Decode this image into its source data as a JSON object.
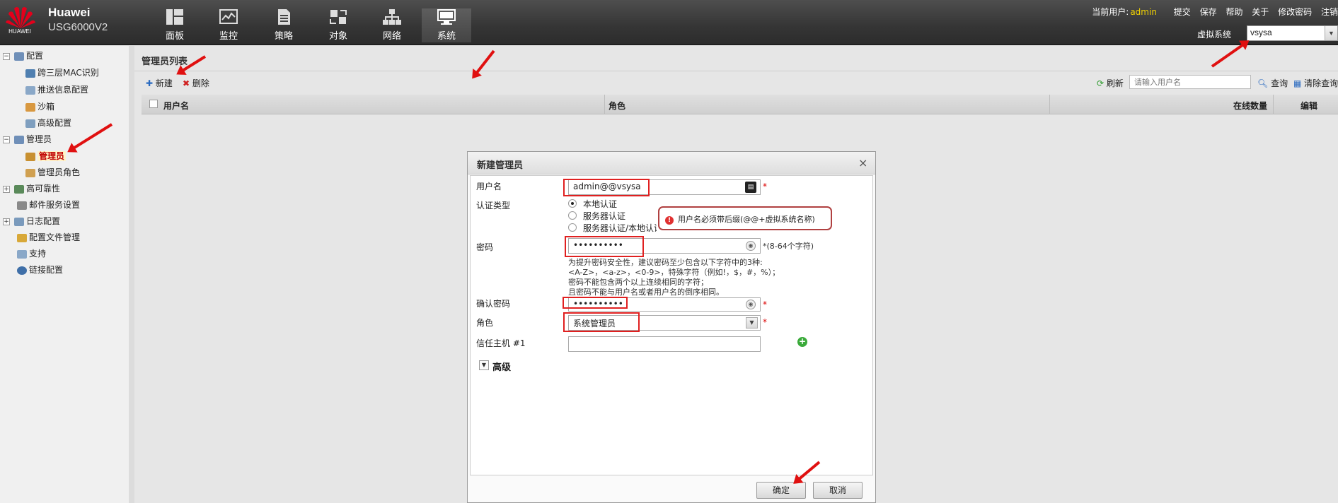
{
  "brand": {
    "logo_text": "HUAWEI",
    "name": "Huawei",
    "model": "USG6000V2"
  },
  "nav": [
    {
      "label": "面板",
      "icon": "dashboard-icon"
    },
    {
      "label": "监控",
      "icon": "monitor-icon"
    },
    {
      "label": "策略",
      "icon": "policy-icon"
    },
    {
      "label": "对象",
      "icon": "object-icon"
    },
    {
      "label": "网络",
      "icon": "network-icon"
    },
    {
      "label": "系统",
      "icon": "system-icon",
      "active": true
    }
  ],
  "topbar": {
    "current_user_label": "当前用户:",
    "current_user": "admin",
    "links": [
      "提交",
      "保存",
      "帮助",
      "关于",
      "修改密码",
      "注销"
    ]
  },
  "vsys": {
    "label": "虚拟系统",
    "value": "vsysa"
  },
  "sidebar": {
    "items": [
      {
        "label": "配置",
        "expander": "−"
      },
      {
        "label": "跨三层MAC识别"
      },
      {
        "label": "推送信息配置"
      },
      {
        "label": "沙箱"
      },
      {
        "label": "高级配置"
      },
      {
        "label": "管理员",
        "expander": "−"
      },
      {
        "label": "管理员",
        "selected": true
      },
      {
        "label": "管理员角色"
      },
      {
        "label": "高可靠性",
        "expander": "+"
      },
      {
        "label": "邮件服务设置"
      },
      {
        "label": "日志配置",
        "expander": "+"
      },
      {
        "label": "配置文件管理"
      },
      {
        "label": "支持"
      },
      {
        "label": "链接配置"
      }
    ]
  },
  "panel": {
    "title": "管理员列表",
    "new_label": "新建",
    "delete_label": "删除",
    "refresh_label": "刷新",
    "search_placeholder": "请输入用户名",
    "query_label": "查询",
    "clear_query_label": "清除查询",
    "columns": [
      "用户名",
      "角色",
      "在线数量",
      "编辑"
    ]
  },
  "dialog": {
    "title": "新建管理员",
    "close": "×",
    "username_label": "用户名",
    "username_value": "admin@@vsysa",
    "auth_type_label": "认证类型",
    "auth_options": [
      "本地认证",
      "服务器认证",
      "服务器认证/本地认证"
    ],
    "auth_selected": 0,
    "password_label": "密码",
    "password_value": "••••••••••",
    "password_hint_len": "*(8-64个字符)",
    "password_rules": [
      "为提升密码安全性，建议密码至少包含以下字符中的3种:",
      "<A-Z>，<a-z>，<0-9>，特殊字符（例如!，$，#，%）；",
      "密码不能包含两个以上连续相同的字符；",
      "且密码不能与用户名或者用户名的倒序相同。"
    ],
    "confirm_label": "确认密码",
    "confirm_value": "••••••••••",
    "role_label": "角色",
    "role_value": "系统管理员",
    "trusted_host_label": "信任主机 #1",
    "advanced_label": "高级",
    "ok_label": "确定",
    "cancel_label": "取消",
    "star": "*"
  },
  "tooltip": {
    "icon": "!",
    "text": "用户名必须带后缀(@@+虚拟系统名称)"
  },
  "colors": {
    "accent_red": "#e02020",
    "user_yellow": "#f2d200",
    "header_dark": "#353535"
  }
}
